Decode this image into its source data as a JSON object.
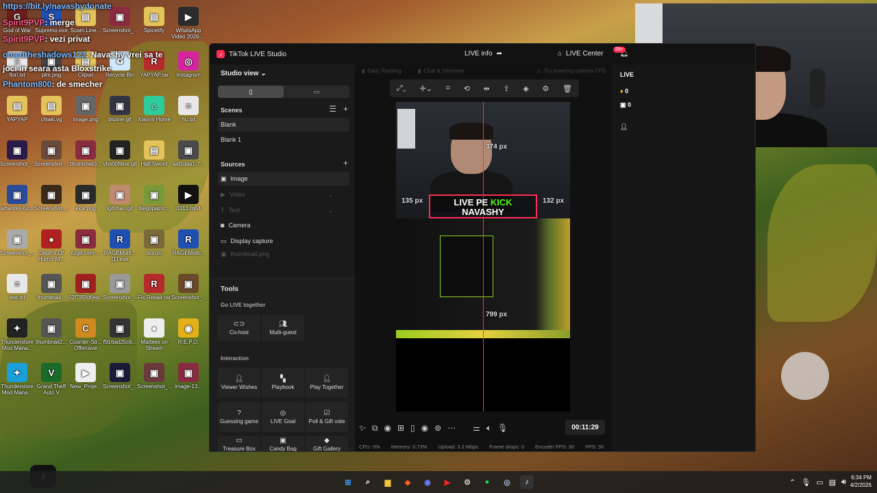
{
  "chat": [
    {
      "user": "https://bit.ly/navashydonate",
      "text": ""
    },
    {
      "user": "Spirit9PVP",
      "text": ": merge"
    },
    {
      "user": "Spirit9PVP",
      "text": ": vezi privat"
    },
    {
      "user": "omedtheshadows123",
      "text": ": Navashy vrei sa te"
    },
    {
      "user": "",
      "text": "joci in seara asta Bloxstrike"
    },
    {
      "user": "Phantom800",
      "text": ": de smecher"
    }
  ],
  "desktop_icons": [
    {
      "label": "God of War",
      "color": "#6b1d1d",
      "glyph": "G"
    },
    {
      "label": "Supremo.exe",
      "color": "#1f4fb0",
      "glyph": "S"
    },
    {
      "label": "Scam.Line...",
      "color": "#e3c35a",
      "glyph": "▤"
    },
    {
      "label": "Screenshot_...",
      "color": "#8a2b3f",
      "glyph": "▣"
    },
    {
      "label": "Spicetify",
      "color": "#e3c35a",
      "glyph": "▤"
    },
    {
      "label": "WhatsApp Video 2026-...",
      "color": "#2c2c2c",
      "glyph": "▶"
    },
    {
      "label": "flori.txt",
      "color": "#e8e8e8",
      "glyph": "≡"
    },
    {
      "label": "plm.png",
      "color": "#444",
      "glyph": "▣"
    },
    {
      "label": "Clipuri",
      "color": "#e3c35a",
      "glyph": "▤"
    },
    {
      "label": "Recycle Bin",
      "color": "#cfe8ff",
      "glyph": "♻"
    },
    {
      "label": "YAPYAP.rar",
      "color": "#b52a2a",
      "glyph": "R"
    },
    {
      "label": "Instagram",
      "color": "#d6249f",
      "glyph": "◎"
    },
    {
      "label": "YAPYAP",
      "color": "#e3c35a",
      "glyph": "▤"
    },
    {
      "label": "chiaki.vg",
      "color": "#e3c35a",
      "glyph": "▤"
    },
    {
      "label": "image.png",
      "color": "#666",
      "glyph": "▣"
    },
    {
      "label": "bluline.gif",
      "color": "#334",
      "glyph": "▣"
    },
    {
      "label": "Xiaomi Home",
      "color": "#2ecc9a",
      "glyph": "⌂"
    },
    {
      "label": "hu.txt",
      "color": "#e8e8e8",
      "glyph": "≡"
    },
    {
      "label": "Screenshot_...",
      "color": "#2a1a4a",
      "glyph": "▣"
    },
    {
      "label": "Screenshot_...",
      "color": "#6a4a3a",
      "glyph": "▣"
    },
    {
      "label": "thumbnail3...",
      "color": "#8a2b3f",
      "glyph": "▣"
    },
    {
      "label": "vbs00ftline.gif",
      "color": "#222",
      "glyph": "▣"
    },
    {
      "label": "Half.Sword",
      "color": "#e3c35a",
      "glyph": "▤"
    },
    {
      "label": "aaf2daa1-7...",
      "color": "#4a4a4a",
      "glyph": "▣"
    },
    {
      "label": "artworks-6p...",
      "color": "#2a4a9a",
      "glyph": "▣"
    },
    {
      "label": "Screenshot_...",
      "color": "#3a2a1a",
      "glyph": "▣"
    },
    {
      "label": "kick.png",
      "color": "#2a2a2a",
      "glyph": "▣"
    },
    {
      "label": "lgifxhan.gif",
      "color": "#c08a70",
      "glyph": "▣"
    },
    {
      "label": "diegopatric...",
      "color": "#7a9a3a",
      "glyph": "▣"
    },
    {
      "label": "0313.mp4",
      "color": "#111",
      "glyph": "▶"
    },
    {
      "label": "Screenshot_...",
      "color": "#aaa",
      "glyph": "▣"
    },
    {
      "label": "Depths Of Horror M...",
      "color": "#b02020",
      "glyph": "●"
    },
    {
      "label": "ezgif.com-...",
      "color": "#8a2b3f",
      "glyph": "▣"
    },
    {
      "label": "RAGEMulti... (1).exe",
      "color": "#1f4fb0",
      "glyph": "R"
    },
    {
      "label": "lsonzo",
      "color": "#7a6a3a",
      "glyph": "▣"
    },
    {
      "label": "RAGEMulti...",
      "color": "#1f4fb0",
      "glyph": "R"
    },
    {
      "label": "test.txt",
      "color": "#e8e8e8",
      "glyph": "≡"
    },
    {
      "label": "thumbnail...",
      "color": "#555",
      "glyph": "▣"
    },
    {
      "label": "02f785fd6ea...",
      "color": "#a02020",
      "glyph": "▣"
    },
    {
      "label": "Screenshot_...",
      "color": "#999",
      "glyph": "▣"
    },
    {
      "label": "Fix Repair.rar",
      "color": "#b52a2a",
      "glyph": "R"
    },
    {
      "label": "Screenshot_...",
      "color": "#6a4a2a",
      "glyph": "▣"
    },
    {
      "label": "Thunderstore Mod Mana...",
      "color": "#222",
      "glyph": "✦"
    },
    {
      "label": "thumbnail2...",
      "color": "#555",
      "glyph": "▣"
    },
    {
      "label": "Counter-Str... Offensive",
      "color": "#d08a20",
      "glyph": "C"
    },
    {
      "label": "f916ad25c6...",
      "color": "#333",
      "glyph": "▣"
    },
    {
      "label": "Marbles on Stream",
      "color": "#eee",
      "glyph": "●"
    },
    {
      "label": "R.E.P.O.",
      "color": "#e3b01a",
      "glyph": "◉"
    },
    {
      "label": "Thunderstore Mod Mana...",
      "color": "#1a9fd6",
      "glyph": "✦"
    },
    {
      "label": "Grand Theft Auto V",
      "color": "#1a6a2a",
      "glyph": "V"
    },
    {
      "label": "New_Proje...",
      "color": "#eee",
      "glyph": "▶"
    },
    {
      "label": "Screenshot_...",
      "color": "#1a1a3a",
      "glyph": "▣"
    },
    {
      "label": "Screenshot_...",
      "color": "#6a3a3a",
      "glyph": "▣"
    },
    {
      "label": "image-13...",
      "color": "#8a2b3f",
      "glyph": "▣"
    }
  ],
  "window": {
    "app_title": "TikTok LIVE Studio",
    "live_info": "LIVE info",
    "live_center": "LIVE Center",
    "notif_badge": "99+"
  },
  "left": {
    "studio_view": "Studio view",
    "scenes_title": "Scenes",
    "scenes": [
      "Blank",
      "Blank 1"
    ],
    "sources_title": "Sources",
    "sources": [
      {
        "label": "Image",
        "icon": "image-icon",
        "dim": false
      },
      {
        "label": "Video",
        "icon": "video-icon",
        "dim": true
      },
      {
        "label": "Text",
        "icon": "text-icon",
        "dim": true
      },
      {
        "label": "Camera",
        "icon": "camera-icon",
        "dim": false
      },
      {
        "label": "Display capture",
        "icon": "monitor-icon",
        "dim": false
      },
      {
        "label": "thumbnail.png",
        "icon": "image-icon",
        "dim": true
      }
    ],
    "tools_title": "Tools",
    "go_live_together": "Go LIVE together",
    "cohost": "Co-host",
    "multiguest": "Multi-guest",
    "interaction": "Interaction",
    "viewer_wishes": "Viewer Wishes",
    "playbook": "Playbook",
    "play_together": "Play Together",
    "guessing_game": "Guessing game",
    "live_goal": "LIVE Goal",
    "poll_gift": "Poll & Gift vote",
    "treasure_box": "Treasure Box",
    "candy_bag": "Candy Bag",
    "gift_gallery": "Gift Gallery"
  },
  "center": {
    "chips": [
      "Daily Ranking",
      "Chat & Interview",
      "Try lowering camera FPS"
    ],
    "banner_line1_a": "LIVE PE ",
    "banner_line1_b": "KICK",
    "banner_line2": "NAVASHY",
    "measure_top": "374 px",
    "measure_left": "135 px",
    "measure_right": "132 px",
    "measure_bottom": "799 px",
    "timer": "00:11:29",
    "stats": {
      "cpu": "CPU: 0%",
      "memory": "Memory: 0.73%",
      "upload": "Upload: 3.2 Mbps",
      "frame_drops": "Frame drops: 0",
      "encoder_fps": "Encoder FPS: 30",
      "fps": "FPS: 30"
    }
  },
  "right": {
    "live": "LIVE",
    "diamonds": "0",
    "gifts": "0"
  },
  "taskbar": {
    "time": "6:34 PM",
    "date": "4/2/2026"
  }
}
